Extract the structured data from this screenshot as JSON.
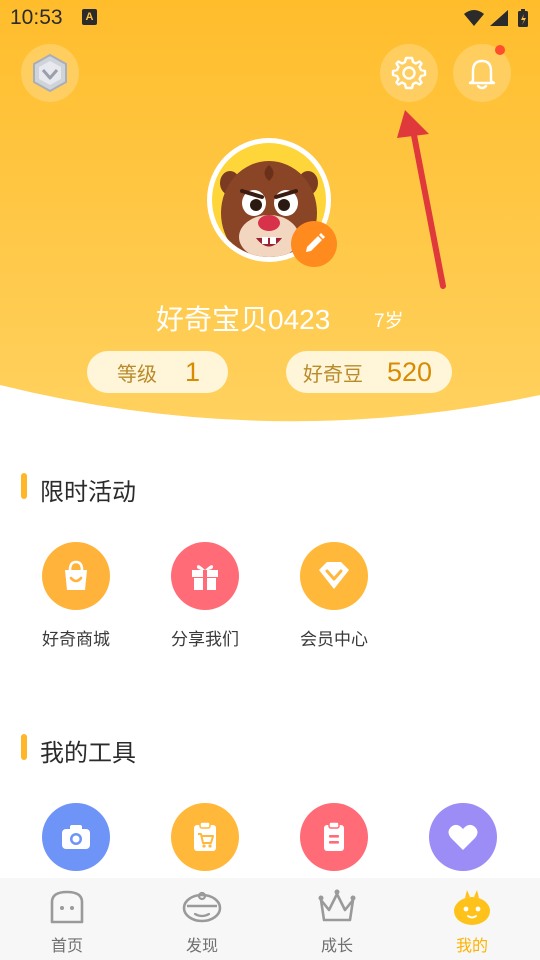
{
  "status_bar": {
    "time": "10:53",
    "notif_glyph": "A"
  },
  "header": {
    "bg_top": "#ffbe2e",
    "bg_bottom": "#ffd166",
    "username": "好奇宝贝0423",
    "age": "7岁",
    "level_label": "等级",
    "level_value": "1",
    "beans_label": "好奇豆",
    "beans_value": "520"
  },
  "sections": {
    "limited": {
      "title": "限时活动",
      "items": [
        {
          "label": "好奇商城",
          "icon": "shopping-bag-icon",
          "color": "#ffb33a"
        },
        {
          "label": "分享我们",
          "icon": "gift-icon",
          "color": "#ff6b76"
        },
        {
          "label": "会员中心",
          "icon": "diamond-icon",
          "color": "#ffb83a"
        }
      ]
    },
    "tools": {
      "title": "我的工具",
      "items": [
        {
          "label": "",
          "icon": "camera-icon",
          "color": "#6e94f7"
        },
        {
          "label": "",
          "icon": "cart-icon",
          "color": "#ffb83a"
        },
        {
          "label": "",
          "icon": "clipboard-icon",
          "color": "#ff6b76"
        },
        {
          "label": "",
          "icon": "heart-icon",
          "color": "#9c8cf5"
        }
      ]
    }
  },
  "bottom_nav": {
    "items": [
      {
        "label": "首页",
        "icon": "home-icon"
      },
      {
        "label": "发现",
        "icon": "discover-icon"
      },
      {
        "label": "成长",
        "icon": "crown-icon"
      },
      {
        "label": "我的",
        "icon": "profile-mascot-icon",
        "active": true
      }
    ],
    "active_color": "#ffb300",
    "inactive_color": "#707070"
  }
}
